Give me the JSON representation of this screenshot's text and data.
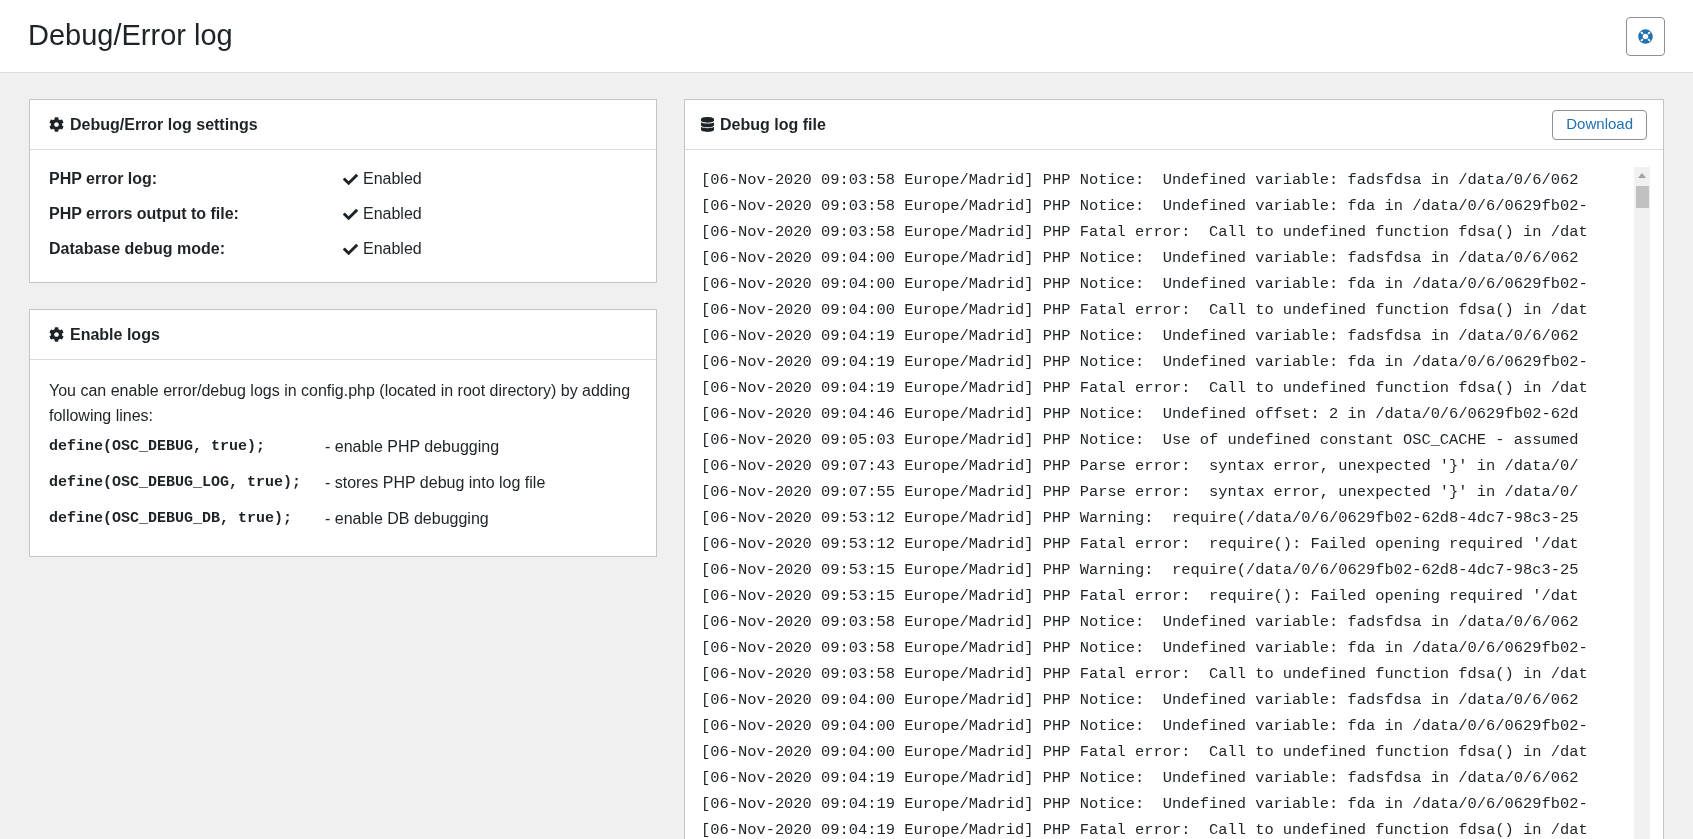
{
  "page_title": "Debug/Error log",
  "settings_card": {
    "title": "Debug/Error log settings",
    "rows": [
      {
        "label": "PHP error log:",
        "value": "Enabled",
        "enabled": true
      },
      {
        "label": "PHP errors output to file:",
        "value": "Enabled",
        "enabled": true
      },
      {
        "label": "Database debug mode:",
        "value": "Enabled",
        "enabled": true
      }
    ]
  },
  "enable_logs_card": {
    "title": "Enable logs",
    "intro": "You can enable error/debug logs in config.php (located in root directory) by adding following lines:",
    "lines": [
      {
        "code": "define(OSC_DEBUG, true);",
        "description": "- enable PHP debugging"
      },
      {
        "code": "define(OSC_DEBUG_LOG, true);",
        "description": "- stores PHP debug into log file"
      },
      {
        "code": "define(OSC_DEBUG_DB, true);",
        "description": "- enable DB debugging"
      }
    ]
  },
  "log_card": {
    "title": "Debug log file",
    "download_button": "Download",
    "lines": [
      "[06-Nov-2020 09:03:58 Europe/Madrid] PHP Notice:  Undefined variable: fadsfdsa in /data/0/6/062",
      "[06-Nov-2020 09:03:58 Europe/Madrid] PHP Notice:  Undefined variable: fda in /data/0/6/0629fb02-",
      "[06-Nov-2020 09:03:58 Europe/Madrid] PHP Fatal error:  Call to undefined function fdsa() in /dat",
      "[06-Nov-2020 09:04:00 Europe/Madrid] PHP Notice:  Undefined variable: fadsfdsa in /data/0/6/062",
      "[06-Nov-2020 09:04:00 Europe/Madrid] PHP Notice:  Undefined variable: fda in /data/0/6/0629fb02-",
      "[06-Nov-2020 09:04:00 Europe/Madrid] PHP Fatal error:  Call to undefined function fdsa() in /dat",
      "[06-Nov-2020 09:04:19 Europe/Madrid] PHP Notice:  Undefined variable: fadsfdsa in /data/0/6/062",
      "[06-Nov-2020 09:04:19 Europe/Madrid] PHP Notice:  Undefined variable: fda in /data/0/6/0629fb02-",
      "[06-Nov-2020 09:04:19 Europe/Madrid] PHP Fatal error:  Call to undefined function fdsa() in /dat",
      "[06-Nov-2020 09:04:46 Europe/Madrid] PHP Notice:  Undefined offset: 2 in /data/0/6/0629fb02-62d",
      "[06-Nov-2020 09:05:03 Europe/Madrid] PHP Notice:  Use of undefined constant OSC_CACHE - assumed",
      "[06-Nov-2020 09:07:43 Europe/Madrid] PHP Parse error:  syntax error, unexpected '}' in /data/0/",
      "[06-Nov-2020 09:07:55 Europe/Madrid] PHP Parse error:  syntax error, unexpected '}' in /data/0/",
      "[06-Nov-2020 09:53:12 Europe/Madrid] PHP Warning:  require(/data/0/6/0629fb02-62d8-4dc7-98c3-25",
      "[06-Nov-2020 09:53:12 Europe/Madrid] PHP Fatal error:  require(): Failed opening required '/dat",
      "[06-Nov-2020 09:53:15 Europe/Madrid] PHP Warning:  require(/data/0/6/0629fb02-62d8-4dc7-98c3-25",
      "[06-Nov-2020 09:53:15 Europe/Madrid] PHP Fatal error:  require(): Failed opening required '/dat",
      "[06-Nov-2020 09:03:58 Europe/Madrid] PHP Notice:  Undefined variable: fadsfdsa in /data/0/6/062",
      "[06-Nov-2020 09:03:58 Europe/Madrid] PHP Notice:  Undefined variable: fda in /data/0/6/0629fb02-",
      "[06-Nov-2020 09:03:58 Europe/Madrid] PHP Fatal error:  Call to undefined function fdsa() in /dat",
      "[06-Nov-2020 09:04:00 Europe/Madrid] PHP Notice:  Undefined variable: fadsfdsa in /data/0/6/062",
      "[06-Nov-2020 09:04:00 Europe/Madrid] PHP Notice:  Undefined variable: fda in /data/0/6/0629fb02-",
      "[06-Nov-2020 09:04:00 Europe/Madrid] PHP Fatal error:  Call to undefined function fdsa() in /dat",
      "[06-Nov-2020 09:04:19 Europe/Madrid] PHP Notice:  Undefined variable: fadsfdsa in /data/0/6/062",
      "[06-Nov-2020 09:04:19 Europe/Madrid] PHP Notice:  Undefined variable: fda in /data/0/6/0629fb02-",
      "[06-Nov-2020 09:04:19 Europe/Madrid] PHP Fatal error:  Call to undefined function fdsa() in /dat"
    ]
  }
}
